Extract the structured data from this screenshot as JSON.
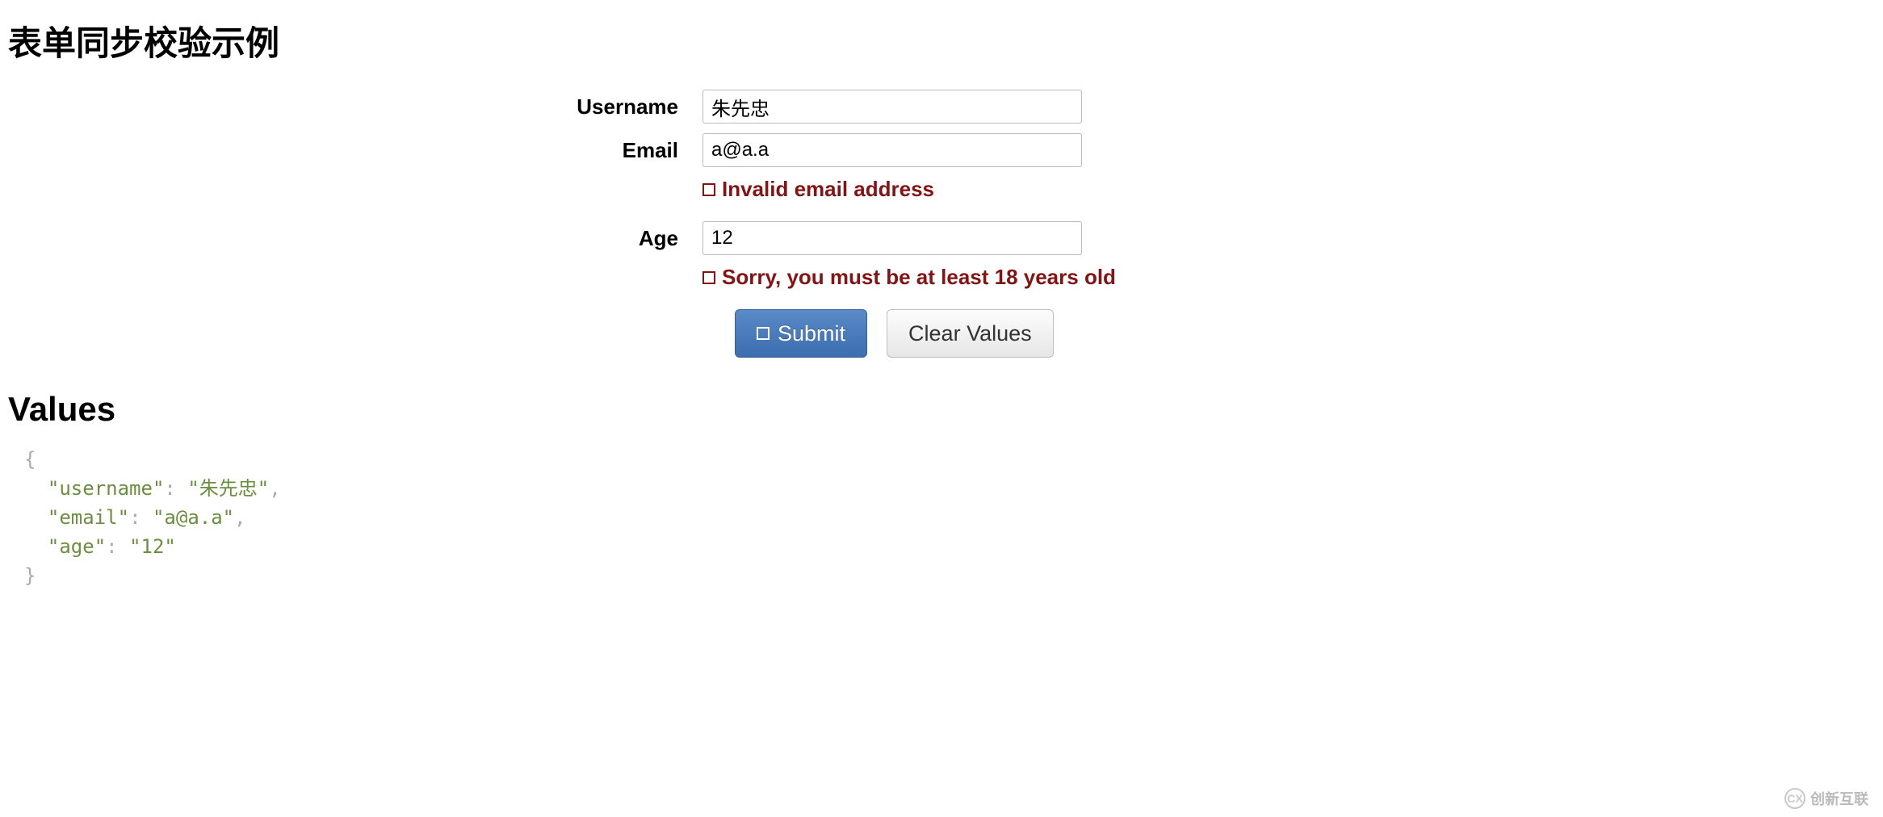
{
  "page_title": "表单同步校验示例",
  "form": {
    "fields": {
      "username": {
        "label": "Username",
        "value": "朱先忠"
      },
      "email": {
        "label": "Email",
        "value": "a@a.a",
        "error": "Invalid email address"
      },
      "age": {
        "label": "Age",
        "value": "12",
        "error": "Sorry, you must be at least 18 years old"
      }
    },
    "buttons": {
      "submit_label": "Submit",
      "clear_label": "Clear Values"
    }
  },
  "values_heading": "Values",
  "values_json": {
    "username": "朱先忠",
    "email": "a@a.a",
    "age": "12"
  },
  "watermark_text": "创新互联"
}
